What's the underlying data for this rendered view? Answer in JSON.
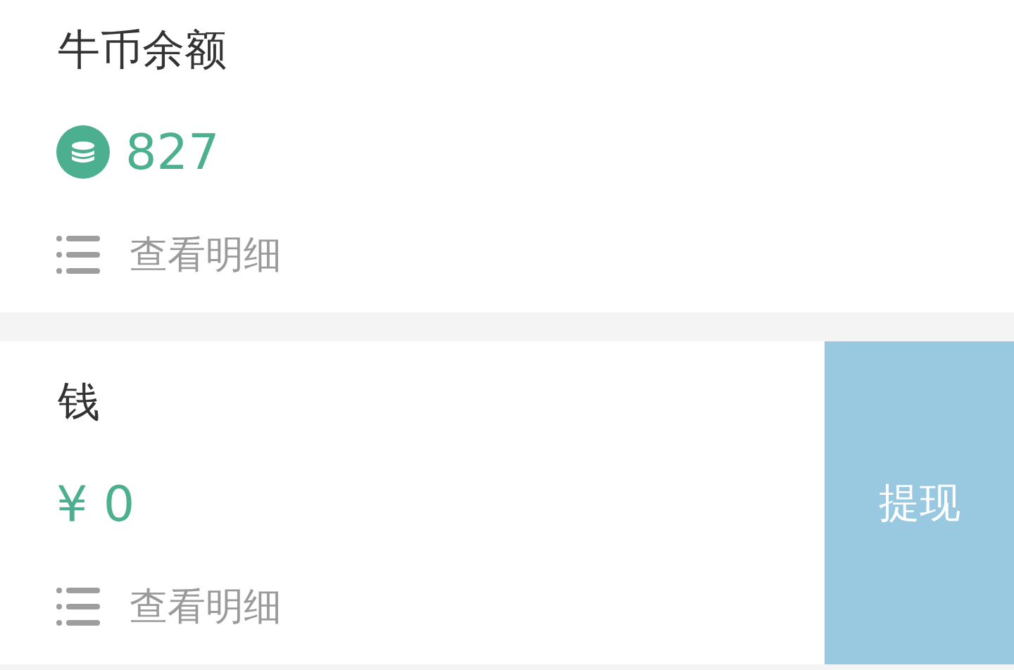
{
  "sections": [
    {
      "kind": "coin",
      "title": "牛币余额",
      "amount": "827",
      "detail_link": "查看明细"
    },
    {
      "kind": "cash",
      "title": "钱",
      "amount": "¥ 0",
      "detail_link": "查看明细",
      "withdraw_button": "提现"
    }
  ]
}
